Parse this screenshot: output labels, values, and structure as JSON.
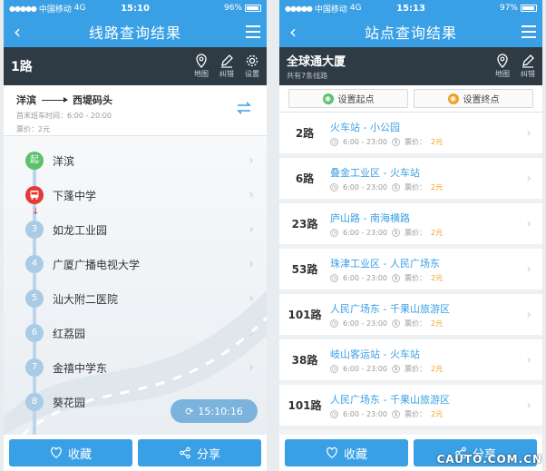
{
  "status": {
    "left": {
      "carrier": "中国移动",
      "network": "4G",
      "time": "15:10",
      "battery": "96%"
    },
    "right": {
      "carrier": "中国移动",
      "network": "4G",
      "time": "15:13",
      "battery": "97%"
    }
  },
  "route_screen": {
    "title": "线路查询结果",
    "route_no": "1路",
    "tools": {
      "map": "地图",
      "error": "纠错",
      "settings": "设置"
    },
    "from": "洋滨",
    "to": "西堤码头",
    "hours": "首末班车时间：6:00 - 20:00",
    "fare": "票价：2元",
    "start_badge": "起",
    "stations": [
      {
        "num": "",
        "name": "洋滨"
      },
      {
        "num": "",
        "name": "下蓬中学"
      },
      {
        "num": "3",
        "name": "如龙工业园"
      },
      {
        "num": "4",
        "name": "广厦广播电视大学"
      },
      {
        "num": "5",
        "name": "汕大附二医院"
      },
      {
        "num": "6",
        "name": "红荔园"
      },
      {
        "num": "7",
        "name": "金禧中学东"
      },
      {
        "num": "8",
        "name": "葵花园"
      }
    ],
    "refresh_time": "15:10:16",
    "favorite": "收藏",
    "share": "分享"
  },
  "station_screen": {
    "title": "站点查询结果",
    "station_name": "全球通大厦",
    "line_count": "共有7条线路",
    "tools": {
      "map": "地图",
      "error": "纠错"
    },
    "set_start": "设置起点",
    "set_end": "设置终点",
    "time_label": "6:00 - 23:00",
    "fare_label": "票价：",
    "fare_value": "2元",
    "lines": [
      {
        "no": "2路",
        "route": "火车站 - 小公园"
      },
      {
        "no": "6路",
        "route": "叠金工业区 - 火车站"
      },
      {
        "no": "23路",
        "route": "庐山路 - 南海横路"
      },
      {
        "no": "53路",
        "route": "珠津工业区 - 人民广场东"
      },
      {
        "no": "101路",
        "route": "人民广场东 - 千果山旅游区"
      },
      {
        "no": "38路",
        "route": "岐山客运站 - 火车站"
      },
      {
        "no": "101路",
        "route": "人民广场东 - 千果山旅游区"
      }
    ],
    "favorite": "收藏",
    "share": "分享"
  },
  "watermark": "CAUTO.COM.CN",
  "colors": {
    "primary": "#3aa0e6",
    "dark_bar": "#2e3a44",
    "start_green": "#5cc26a",
    "bus_red": "#e53935",
    "fare_orange": "#f0a020"
  }
}
